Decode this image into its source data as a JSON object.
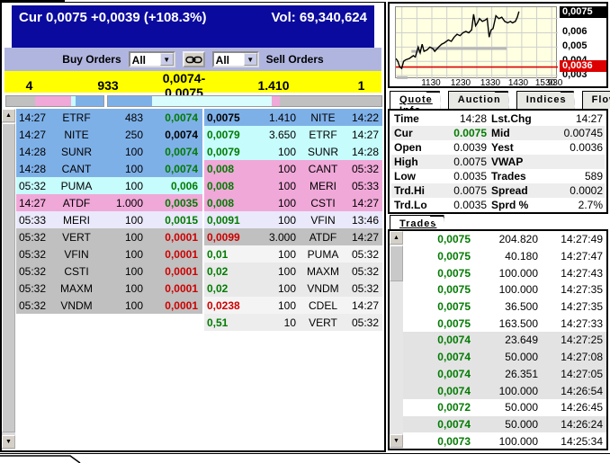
{
  "header": {
    "cur": "Cur 0,0075 +0,0039 (+108.3%)",
    "vol": "Vol: 69,340,624",
    "bg": "#0A0A9E"
  },
  "toolbar": {
    "buy_orders_label": "Buy Orders",
    "sell_orders_label": "Sell Orders",
    "buy_filter_value": "All",
    "sell_filter_value": "All",
    "link_icon": "chain-link-icon"
  },
  "summary_row": {
    "bid_orders": "4",
    "bid_qty": "933",
    "best_bid_ask": "0,0074-0,0075",
    "ask_qty": "1.410",
    "ask_orders": "1",
    "bg": "#FFFF00"
  },
  "depth_bars": {
    "left": [
      {
        "color": "#C0C0C0",
        "pct": 30
      },
      {
        "color": "#F0A8D8",
        "pct": 37
      },
      {
        "color": "#C6FCFC",
        "pct": 4
      },
      {
        "color": "#7EB0E8",
        "pct": 29
      }
    ],
    "right": [
      {
        "color": "#7EB0E8",
        "pct": 16
      },
      {
        "color": "#D9FDFD",
        "pct": 44
      },
      {
        "color": "#F0A8D8",
        "pct": 3
      },
      {
        "color": "#C0C0C0",
        "pct": 37
      }
    ]
  },
  "order_book": {
    "bids": [
      {
        "time": "14:27",
        "name": "ETRF",
        "qty": "483",
        "price": "0,0074",
        "bg": "#7EB0E8",
        "pc": "green"
      },
      {
        "time": "14:27",
        "name": "NITE",
        "qty": "250",
        "price": "0,0074",
        "bg": "#7EB0E8",
        "pc": "black"
      },
      {
        "time": "14:28",
        "name": "SUNR",
        "qty": "100",
        "price": "0,0074",
        "bg": "#7EB0E8",
        "pc": "green"
      },
      {
        "time": "14:28",
        "name": "CANT",
        "qty": "100",
        "price": "0,0074",
        "bg": "#7EB0E8",
        "pc": "green"
      },
      {
        "time": "05:32",
        "name": "PUMA",
        "qty": "100",
        "price": "0,006",
        "bg": "#C6FCFC",
        "pc": "green"
      },
      {
        "time": "14:27",
        "name": "ATDF",
        "qty": "1.000",
        "price": "0,0035",
        "bg": "#F0A8D8",
        "pc": "green"
      },
      {
        "time": "05:33",
        "name": "MERI",
        "qty": "100",
        "price": "0,0015",
        "bg": "#E9E9FB",
        "pc": "green"
      },
      {
        "time": "05:32",
        "name": "VERT",
        "qty": "100",
        "price": "0,0001",
        "bg": "#C0C0C0",
        "pc": "red"
      },
      {
        "time": "05:32",
        "name": "VFIN",
        "qty": "100",
        "price": "0,0001",
        "bg": "#C0C0C0",
        "pc": "red"
      },
      {
        "time": "05:32",
        "name": "CSTI",
        "qty": "100",
        "price": "0,0001",
        "bg": "#C0C0C0",
        "pc": "red"
      },
      {
        "time": "05:32",
        "name": "MAXM",
        "qty": "100",
        "price": "0,0001",
        "bg": "#C0C0C0",
        "pc": "red"
      },
      {
        "time": "05:32",
        "name": "VNDM",
        "qty": "100",
        "price": "0,0001",
        "bg": "#C0C0C0",
        "pc": "red"
      }
    ],
    "asks": [
      {
        "price": "0,0075",
        "qty": "1.410",
        "name": "NITE",
        "time": "14:22",
        "bg": "#7EB0E8",
        "pc": "black"
      },
      {
        "price": "0,0079",
        "qty": "3.650",
        "name": "ETRF",
        "time": "14:27",
        "bg": "#C6FCFC",
        "pc": "green"
      },
      {
        "price": "0,0079",
        "qty": "100",
        "name": "SUNR",
        "time": "14:28",
        "bg": "#C6FCFC",
        "pc": "green"
      },
      {
        "price": "0,008",
        "qty": "100",
        "name": "CANT",
        "time": "05:32",
        "bg": "#F0A8D8",
        "pc": "green"
      },
      {
        "price": "0,008",
        "qty": "100",
        "name": "MERI",
        "time": "05:33",
        "bg": "#F0A8D8",
        "pc": "green"
      },
      {
        "price": "0,008",
        "qty": "100",
        "name": "CSTI",
        "time": "14:27",
        "bg": "#F0A8D8",
        "pc": "green"
      },
      {
        "price": "0,0091",
        "qty": "100",
        "name": "VFIN",
        "time": "13:46",
        "bg": "#E9E9FB",
        "pc": "green"
      },
      {
        "price": "0,0099",
        "qty": "3.000",
        "name": "ATDF",
        "time": "14:27",
        "bg": "#C0C0C0",
        "pc": "red"
      },
      {
        "price": "0,01",
        "qty": "100",
        "name": "PUMA",
        "time": "05:32",
        "bg": "#F4F4F4",
        "pc": "green"
      },
      {
        "price": "0,02",
        "qty": "100",
        "name": "MAXM",
        "time": "05:32",
        "bg": "#E9E9E9",
        "pc": "green"
      },
      {
        "price": "0,02",
        "qty": "100",
        "name": "VNDM",
        "time": "05:32",
        "bg": "#E9E9E9",
        "pc": "green"
      },
      {
        "price": "0,0238",
        "qty": "100",
        "name": "CDEL",
        "time": "14:27",
        "bg": "#F4F4F4",
        "pc": "red"
      },
      {
        "price": "0,51",
        "qty": "10",
        "name": "VERT",
        "time": "05:32",
        "bg": "#EDEDED",
        "pc": "green"
      }
    ]
  },
  "chart_data": {
    "type": "line",
    "background": "#FFFFE1",
    "line_color": "#000000",
    "y_range": [
      0.00275,
      0.0078
    ],
    "y_labels": [
      {
        "text": "0,0075",
        "price": 0.0075,
        "style": "current"
      },
      {
        "text": "0,006",
        "price": 0.006,
        "style": "plain"
      },
      {
        "text": "0,005",
        "price": 0.005,
        "style": "plain"
      },
      {
        "text": "0,004",
        "price": 0.004,
        "style": "plain"
      },
      {
        "text": "0,0036",
        "price": 0.0036,
        "style": "yest"
      },
      {
        "text": "0,003",
        "price": 0.003,
        "style": "plain"
      }
    ],
    "x_labels": [
      {
        "text": "1130",
        "frac": 0.22
      },
      {
        "text": "1230",
        "frac": 0.405
      },
      {
        "text": "1330",
        "frac": 0.59
      },
      {
        "text": "1430",
        "frac": 0.76
      },
      {
        "text": "1530",
        "frac": 0.93
      },
      {
        "text": "930",
        "frac": 0.99
      }
    ],
    "yest_line": {
      "price": 0.0036,
      "color": "#DD0000"
    },
    "gray_segments": [
      {
        "x1": 0.216,
        "x2": 0.684,
        "price": 0.0049
      },
      {
        "x1": 0.096,
        "x2": 0.156,
        "price": 0.0047
      },
      {
        "x1": 0.006,
        "x2": 0.072,
        "price": 0.00285
      }
    ],
    "h_gridlines": [
      0.007,
      0.006,
      0.005,
      0.004,
      0.003
    ],
    "points": [
      [
        0.0,
        0.0042
      ],
      [
        0.012,
        0.004
      ],
      [
        0.024,
        0.0036
      ],
      [
        0.036,
        0.0035
      ],
      [
        0.048,
        0.004
      ],
      [
        0.06,
        0.0041
      ],
      [
        0.084,
        0.0042
      ],
      [
        0.108,
        0.0044
      ],
      [
        0.12,
        0.0043
      ],
      [
        0.138,
        0.005
      ],
      [
        0.15,
        0.0046
      ],
      [
        0.162,
        0.0052
      ],
      [
        0.174,
        0.0047
      ],
      [
        0.192,
        0.0048
      ],
      [
        0.21,
        0.005
      ],
      [
        0.228,
        0.0049
      ],
      [
        0.24,
        0.0047
      ],
      [
        0.264,
        0.005
      ],
      [
        0.282,
        0.0052
      ],
      [
        0.3,
        0.0053
      ],
      [
        0.324,
        0.0055
      ],
      [
        0.342,
        0.0054
      ],
      [
        0.36,
        0.0057
      ],
      [
        0.378,
        0.0059
      ],
      [
        0.396,
        0.0058
      ],
      [
        0.414,
        0.006
      ],
      [
        0.432,
        0.0061
      ],
      [
        0.45,
        0.006
      ],
      [
        0.468,
        0.0062
      ],
      [
        0.48,
        0.0073
      ],
      [
        0.492,
        0.0065
      ],
      [
        0.504,
        0.0067
      ],
      [
        0.516,
        0.007
      ],
      [
        0.534,
        0.0068
      ],
      [
        0.552,
        0.0069
      ],
      [
        0.564,
        0.007
      ],
      [
        0.576,
        0.0057
      ],
      [
        0.588,
        0.0062
      ],
      [
        0.6,
        0.0063
      ],
      [
        0.618,
        0.0072
      ],
      [
        0.636,
        0.007
      ],
      [
        0.654,
        0.0071
      ],
      [
        0.672,
        0.0068
      ],
      [
        0.69,
        0.0067
      ],
      [
        0.708,
        0.0068
      ],
      [
        0.72,
        0.0067
      ],
      [
        0.738,
        0.0068
      ],
      [
        0.75,
        0.0071
      ],
      [
        0.76,
        0.0075
      ]
    ]
  },
  "right_tabs": [
    {
      "label": "Quote Info",
      "active": true
    },
    {
      "label": "Auction",
      "active": false
    },
    {
      "label": "Indices",
      "active": false
    },
    {
      "label": "Flow",
      "active": false
    }
  ],
  "quote_info": {
    "rows": [
      {
        "l1": "Time",
        "v1": "14:28",
        "l2": "Lst.Chg",
        "v2": "14:27",
        "shade": false,
        "v1_green": false
      },
      {
        "l1": "Cur",
        "v1": "0.0075",
        "l2": "Mid",
        "v2": "0.00745",
        "shade": true,
        "v1_green": true
      },
      {
        "l1": "Open",
        "v1": "0.0039",
        "l2": "Yest",
        "v2": "0.0036",
        "shade": false,
        "v1_green": false
      },
      {
        "l1": "High",
        "v1": "0.0075",
        "l2": "VWAP",
        "v2": "",
        "shade": true,
        "v1_green": false
      },
      {
        "l1": "Low",
        "v1": "0.0035",
        "l2": "Trades",
        "v2": "589",
        "shade": false,
        "v1_green": false
      },
      {
        "l1": "Trd.Hi",
        "v1": "0.0075",
        "l2": "Spread",
        "v2": "0.0002",
        "shade": true,
        "v1_green": false
      },
      {
        "l1": "Trd.Lo",
        "v1": "0.0035",
        "l2": "Sprd %",
        "v2": "2.7%",
        "shade": false,
        "v1_green": false
      }
    ]
  },
  "trades_panel": {
    "tab_label": "Trades",
    "trades": [
      {
        "price": "0,0075",
        "qty": "204.820",
        "time": "14:27:49",
        "shaded": false
      },
      {
        "price": "0,0075",
        "qty": "40.180",
        "time": "14:27:47",
        "shaded": false
      },
      {
        "price": "0,0075",
        "qty": "100.000",
        "time": "14:27:43",
        "shaded": false
      },
      {
        "price": "0,0075",
        "qty": "100.000",
        "time": "14:27:35",
        "shaded": false
      },
      {
        "price": "0,0075",
        "qty": "36.500",
        "time": "14:27:35",
        "shaded": false
      },
      {
        "price": "0,0075",
        "qty": "163.500",
        "time": "14:27:33",
        "shaded": false
      },
      {
        "price": "0,0074",
        "qty": "23.649",
        "time": "14:27:25",
        "shaded": true
      },
      {
        "price": "0,0074",
        "qty": "50.000",
        "time": "14:27:08",
        "shaded": true
      },
      {
        "price": "0,0074",
        "qty": "26.351",
        "time": "14:27:05",
        "shaded": true
      },
      {
        "price": "0,0074",
        "qty": "100.000",
        "time": "14:26:54",
        "shaded": true
      },
      {
        "price": "0,0072",
        "qty": "50.000",
        "time": "14:26:45",
        "shaded": false
      },
      {
        "price": "0,0074",
        "qty": "50.000",
        "time": "14:26:24",
        "shaded": true
      },
      {
        "price": "0,0073",
        "qty": "100.000",
        "time": "14:25:34",
        "shaded": false
      }
    ]
  },
  "colors": {
    "header_bg": "#0A0A9E",
    "toolbar_bg": "#B0B5E0",
    "summary_bg": "#FFFF00",
    "green_text": "#007B00",
    "red_text": "#CC0000",
    "level_blue": "#7EB0E8",
    "level_cyan": "#C6FCFC",
    "level_pink": "#F0A8D8",
    "level_lavender": "#E9E9FB",
    "level_gray": "#C0C0C0"
  }
}
